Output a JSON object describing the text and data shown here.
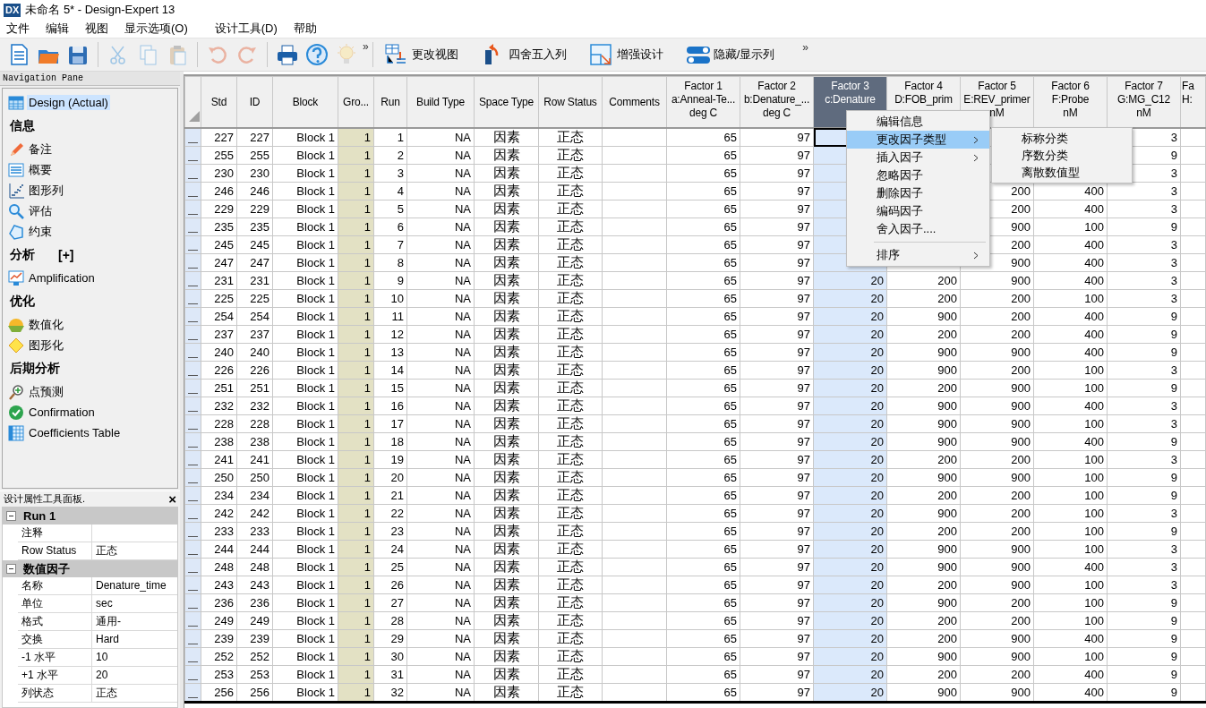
{
  "window": {
    "logo": "DX",
    "title": "未命名 5* - Design-Expert 13"
  },
  "menu_bar": [
    "文件",
    "编辑",
    "视图",
    "显示选项(O)",
    "设计工具(D)",
    "帮助"
  ],
  "toolbar": {
    "icon_buttons": [
      {
        "disabled": false
      },
      {
        "disabled": false
      },
      {
        "disabled": false
      },
      {
        "disabled": true
      },
      {
        "disabled": true
      },
      {
        "disabled": true
      },
      {
        "disabled": true
      },
      {
        "disabled": true
      },
      {
        "disabled": false
      },
      {
        "disabled": false
      },
      {
        "disabled": true
      }
    ],
    "overflow": "»",
    "view_buttons": [
      {
        "label": "更改视图"
      },
      {
        "label": "四舍五入列"
      },
      {
        "label": "增强设计"
      },
      {
        "label": "隐藏/显示列"
      }
    ],
    "view_overflow": "»"
  },
  "navigation_pane": {
    "title": "Navigation Pane",
    "items": [
      {
        "kind": "item",
        "label": "Design (Actual)",
        "selected": true
      },
      {
        "kind": "section",
        "label": "信息"
      },
      {
        "kind": "item",
        "label": "备注",
        "selected": false
      },
      {
        "kind": "item",
        "label": "概要",
        "selected": false
      },
      {
        "kind": "item",
        "label": "图形列",
        "selected": false
      },
      {
        "kind": "item",
        "label": "评估",
        "selected": false
      },
      {
        "kind": "item",
        "label": "约束",
        "selected": false
      },
      {
        "kind": "section",
        "label": "分析",
        "toggle": "[+]"
      },
      {
        "kind": "item",
        "label": "Amplification",
        "selected": false
      },
      {
        "kind": "section",
        "label": "优化"
      },
      {
        "kind": "item",
        "label": "数值化",
        "selected": false
      },
      {
        "kind": "item",
        "label": "图形化",
        "selected": false
      },
      {
        "kind": "section",
        "label": "后期分析"
      },
      {
        "kind": "item",
        "label": "点预测",
        "selected": false
      },
      {
        "kind": "item",
        "label": "Confirmation",
        "selected": false
      },
      {
        "kind": "item",
        "label": "Coefficients Table",
        "selected": false
      }
    ]
  },
  "properties_panel": {
    "title": "设计属性工具面板.",
    "close": "×",
    "groups": [
      {
        "title": "Run 1",
        "expanded": true,
        "rows": [
          {
            "name": "注释"
          },
          {
            "name": "Row Status",
            "value": "正态"
          }
        ]
      },
      {
        "title": "数值因子",
        "expanded": true,
        "rows": [
          {
            "name": "名称",
            "value": "Denature_time"
          },
          {
            "name": "单位",
            "value": "sec"
          },
          {
            "name": "格式",
            "value": "通用-"
          },
          {
            "name": "交换",
            "value": "Hard"
          },
          {
            "name": "-1 水平",
            "value": "10"
          },
          {
            "name": "+1 水平",
            "value": "20"
          },
          {
            "name": "列状态",
            "value": "正态"
          }
        ]
      }
    ]
  },
  "table": {
    "columns": [
      {
        "lines": [
          "Std"
        ],
        "selected": false
      },
      {
        "lines": [
          "ID"
        ],
        "selected": false
      },
      {
        "lines": [
          "Block"
        ],
        "selected": false
      },
      {
        "lines": [
          "Gro..."
        ],
        "selected": false
      },
      {
        "lines": [
          "Run"
        ],
        "selected": false
      },
      {
        "lines": [
          "Build Type"
        ],
        "selected": false
      },
      {
        "lines": [
          "Space Type"
        ],
        "selected": false
      },
      {
        "lines": [
          "Row Status"
        ],
        "selected": false
      },
      {
        "lines": [
          "Comments"
        ],
        "selected": false
      },
      {
        "lines": [
          "Factor 1",
          "a:Anneal-Te...",
          "deg C"
        ],
        "selected": false
      },
      {
        "lines": [
          "Factor 2",
          "b:Denature_...",
          "deg C"
        ],
        "selected": false
      },
      {
        "lines": [
          "Factor 3",
          "c:Denature"
        ],
        "selected": true
      },
      {
        "lines": [
          "Factor 4",
          "D:FOB_prim"
        ],
        "selected": false
      },
      {
        "lines": [
          "Factor 5",
          "E:REV_primer",
          "nM"
        ],
        "selected": false
      },
      {
        "lines": [
          "Factor 6",
          "F:Probe",
          "nM"
        ],
        "selected": false
      },
      {
        "lines": [
          "Factor 7",
          "G:MG_C12",
          "nM"
        ],
        "selected": false
      },
      {
        "lines": [
          "Fa",
          "H:"
        ],
        "selected": false
      }
    ],
    "rows": [
      {
        "current": true,
        "std": "227",
        "id": "227",
        "block": "Block 1",
        "group": "1",
        "run": "1",
        "build_type": "NA",
        "space_type": "因素",
        "row_status": "正态",
        "factor_1": "65",
        "factor_2": "97",
        "factor_7": "3"
      },
      {
        "current": false,
        "std": "255",
        "id": "255",
        "block": "Block 1",
        "group": "1",
        "run": "2",
        "build_type": "NA",
        "space_type": "因素",
        "row_status": "正态",
        "factor_1": "65",
        "factor_2": "97",
        "factor_7": "9"
      },
      {
        "current": false,
        "std": "230",
        "id": "230",
        "block": "Block 1",
        "group": "1",
        "run": "3",
        "build_type": "NA",
        "space_type": "因素",
        "row_status": "正态",
        "factor_1": "65",
        "factor_2": "97",
        "factor_7": "3"
      },
      {
        "current": false,
        "std": "246",
        "id": "246",
        "block": "Block 1",
        "group": "1",
        "run": "4",
        "build_type": "NA",
        "space_type": "因素",
        "row_status": "正态",
        "factor_1": "65",
        "factor_2": "97",
        "factor_5": "200",
        "factor_6": "400",
        "factor_7": "3"
      },
      {
        "current": false,
        "std": "229",
        "id": "229",
        "block": "Block 1",
        "group": "1",
        "run": "5",
        "build_type": "NA",
        "space_type": "因素",
        "row_status": "正态",
        "factor_1": "65",
        "factor_2": "97",
        "factor_5": "200",
        "factor_6": "400",
        "factor_7": "3"
      },
      {
        "current": false,
        "std": "235",
        "id": "235",
        "block": "Block 1",
        "group": "1",
        "run": "6",
        "build_type": "NA",
        "space_type": "因素",
        "row_status": "正态",
        "factor_1": "65",
        "factor_2": "97",
        "factor_5": "900",
        "factor_6": "100",
        "factor_7": "9"
      },
      {
        "current": false,
        "std": "245",
        "id": "245",
        "block": "Block 1",
        "group": "1",
        "run": "7",
        "build_type": "NA",
        "space_type": "因素",
        "row_status": "正态",
        "factor_1": "65",
        "factor_2": "97",
        "factor_5": "200",
        "factor_6": "400",
        "factor_7": "3"
      },
      {
        "current": false,
        "std": "247",
        "id": "247",
        "block": "Block 1",
        "group": "1",
        "run": "8",
        "build_type": "NA",
        "space_type": "因素",
        "row_status": "正态",
        "factor_1": "65",
        "factor_2": "97",
        "factor_5": "900",
        "factor_6": "400",
        "factor_7": "3"
      },
      {
        "current": false,
        "std": "231",
        "id": "231",
        "block": "Block 1",
        "group": "1",
        "run": "9",
        "build_type": "NA",
        "space_type": "因素",
        "row_status": "正态",
        "factor_1": "65",
        "factor_2": "97",
        "factor_3": "20",
        "factor_4": "200",
        "factor_5": "900",
        "factor_6": "400",
        "factor_7": "3"
      },
      {
        "current": false,
        "std": "225",
        "id": "225",
        "block": "Block 1",
        "group": "1",
        "run": "10",
        "build_type": "NA",
        "space_type": "因素",
        "row_status": "正态",
        "factor_1": "65",
        "factor_2": "97",
        "factor_3": "20",
        "factor_4": "200",
        "factor_5": "200",
        "factor_6": "100",
        "factor_7": "3"
      },
      {
        "current": false,
        "std": "254",
        "id": "254",
        "block": "Block 1",
        "group": "1",
        "run": "11",
        "build_type": "NA",
        "space_type": "因素",
        "row_status": "正态",
        "factor_1": "65",
        "factor_2": "97",
        "factor_3": "20",
        "factor_4": "900",
        "factor_5": "200",
        "factor_6": "400",
        "factor_7": "9"
      },
      {
        "current": false,
        "std": "237",
        "id": "237",
        "block": "Block 1",
        "group": "1",
        "run": "12",
        "build_type": "NA",
        "space_type": "因素",
        "row_status": "正态",
        "factor_1": "65",
        "factor_2": "97",
        "factor_3": "20",
        "factor_4": "200",
        "factor_5": "200",
        "factor_6": "400",
        "factor_7": "9"
      },
      {
        "current": false,
        "std": "240",
        "id": "240",
        "block": "Block 1",
        "group": "1",
        "run": "13",
        "build_type": "NA",
        "space_type": "因素",
        "row_status": "正态",
        "factor_1": "65",
        "factor_2": "97",
        "factor_3": "20",
        "factor_4": "900",
        "factor_5": "900",
        "factor_6": "400",
        "factor_7": "9"
      },
      {
        "current": false,
        "std": "226",
        "id": "226",
        "block": "Block 1",
        "group": "1",
        "run": "14",
        "build_type": "NA",
        "space_type": "因素",
        "row_status": "正态",
        "factor_1": "65",
        "factor_2": "97",
        "factor_3": "20",
        "factor_4": "900",
        "factor_5": "200",
        "factor_6": "100",
        "factor_7": "3"
      },
      {
        "current": false,
        "std": "251",
        "id": "251",
        "block": "Block 1",
        "group": "1",
        "run": "15",
        "build_type": "NA",
        "space_type": "因素",
        "row_status": "正态",
        "factor_1": "65",
        "factor_2": "97",
        "factor_3": "20",
        "factor_4": "200",
        "factor_5": "900",
        "factor_6": "100",
        "factor_7": "9"
      },
      {
        "current": false,
        "std": "232",
        "id": "232",
        "block": "Block 1",
        "group": "1",
        "run": "16",
        "build_type": "NA",
        "space_type": "因素",
        "row_status": "正态",
        "factor_1": "65",
        "factor_2": "97",
        "factor_3": "20",
        "factor_4": "900",
        "factor_5": "900",
        "factor_6": "400",
        "factor_7": "3"
      },
      {
        "current": false,
        "std": "228",
        "id": "228",
        "block": "Block 1",
        "group": "1",
        "run": "17",
        "build_type": "NA",
        "space_type": "因素",
        "row_status": "正态",
        "factor_1": "65",
        "factor_2": "97",
        "factor_3": "20",
        "factor_4": "900",
        "factor_5": "900",
        "factor_6": "100",
        "factor_7": "3"
      },
      {
        "current": false,
        "std": "238",
        "id": "238",
        "block": "Block 1",
        "group": "1",
        "run": "18",
        "build_type": "NA",
        "space_type": "因素",
        "row_status": "正态",
        "factor_1": "65",
        "factor_2": "97",
        "factor_3": "20",
        "factor_4": "900",
        "factor_5": "900",
        "factor_6": "400",
        "factor_7": "9"
      },
      {
        "current": false,
        "std": "241",
        "id": "241",
        "block": "Block 1",
        "group": "1",
        "run": "19",
        "build_type": "NA",
        "space_type": "因素",
        "row_status": "正态",
        "factor_1": "65",
        "factor_2": "97",
        "factor_3": "20",
        "factor_4": "200",
        "factor_5": "200",
        "factor_6": "100",
        "factor_7": "3"
      },
      {
        "current": false,
        "std": "250",
        "id": "250",
        "block": "Block 1",
        "group": "1",
        "run": "20",
        "build_type": "NA",
        "space_type": "因素",
        "row_status": "正态",
        "factor_1": "65",
        "factor_2": "97",
        "factor_3": "20",
        "factor_4": "900",
        "factor_5": "900",
        "factor_6": "100",
        "factor_7": "9"
      },
      {
        "current": false,
        "std": "234",
        "id": "234",
        "block": "Block 1",
        "group": "1",
        "run": "21",
        "build_type": "NA",
        "space_type": "因素",
        "row_status": "正态",
        "factor_1": "65",
        "factor_2": "97",
        "factor_3": "20",
        "factor_4": "200",
        "factor_5": "200",
        "factor_6": "100",
        "factor_7": "9"
      },
      {
        "current": false,
        "std": "242",
        "id": "242",
        "block": "Block 1",
        "group": "1",
        "run": "22",
        "build_type": "NA",
        "space_type": "因素",
        "row_status": "正态",
        "factor_1": "65",
        "factor_2": "97",
        "factor_3": "20",
        "factor_4": "900",
        "factor_5": "200",
        "factor_6": "100",
        "factor_7": "3"
      },
      {
        "current": false,
        "std": "233",
        "id": "233",
        "block": "Block 1",
        "group": "1",
        "run": "23",
        "build_type": "NA",
        "space_type": "因素",
        "row_status": "正态",
        "factor_1": "65",
        "factor_2": "97",
        "factor_3": "20",
        "factor_4": "200",
        "factor_5": "200",
        "factor_6": "100",
        "factor_7": "9"
      },
      {
        "current": false,
        "std": "244",
        "id": "244",
        "block": "Block 1",
        "group": "1",
        "run": "24",
        "build_type": "NA",
        "space_type": "因素",
        "row_status": "正态",
        "factor_1": "65",
        "factor_2": "97",
        "factor_3": "20",
        "factor_4": "900",
        "factor_5": "900",
        "factor_6": "100",
        "factor_7": "3"
      },
      {
        "current": false,
        "std": "248",
        "id": "248",
        "block": "Block 1",
        "group": "1",
        "run": "25",
        "build_type": "NA",
        "space_type": "因素",
        "row_status": "正态",
        "factor_1": "65",
        "factor_2": "97",
        "factor_3": "20",
        "factor_4": "900",
        "factor_5": "900",
        "factor_6": "400",
        "factor_7": "3"
      },
      {
        "current": false,
        "std": "243",
        "id": "243",
        "block": "Block 1",
        "group": "1",
        "run": "26",
        "build_type": "NA",
        "space_type": "因素",
        "row_status": "正态",
        "factor_1": "65",
        "factor_2": "97",
        "factor_3": "20",
        "factor_4": "200",
        "factor_5": "900",
        "factor_6": "100",
        "factor_7": "3"
      },
      {
        "current": false,
        "std": "236",
        "id": "236",
        "block": "Block 1",
        "group": "1",
        "run": "27",
        "build_type": "NA",
        "space_type": "因素",
        "row_status": "正态",
        "factor_1": "65",
        "factor_2": "97",
        "factor_3": "20",
        "factor_4": "900",
        "factor_5": "200",
        "factor_6": "100",
        "factor_7": "9"
      },
      {
        "current": false,
        "std": "249",
        "id": "249",
        "block": "Block 1",
        "group": "1",
        "run": "28",
        "build_type": "NA",
        "space_type": "因素",
        "row_status": "正态",
        "factor_1": "65",
        "factor_2": "97",
        "factor_3": "20",
        "factor_4": "200",
        "factor_5": "200",
        "factor_6": "100",
        "factor_7": "9"
      },
      {
        "current": false,
        "std": "239",
        "id": "239",
        "block": "Block 1",
        "group": "1",
        "run": "29",
        "build_type": "NA",
        "space_type": "因素",
        "row_status": "正态",
        "factor_1": "65",
        "factor_2": "97",
        "factor_3": "20",
        "factor_4": "200",
        "factor_5": "900",
        "factor_6": "400",
        "factor_7": "9"
      },
      {
        "current": false,
        "std": "252",
        "id": "252",
        "block": "Block 1",
        "group": "1",
        "run": "30",
        "build_type": "NA",
        "space_type": "因素",
        "row_status": "正态",
        "factor_1": "65",
        "factor_2": "97",
        "factor_3": "20",
        "factor_4": "900",
        "factor_5": "900",
        "factor_6": "100",
        "factor_7": "9"
      },
      {
        "current": false,
        "std": "253",
        "id": "253",
        "block": "Block 1",
        "group": "1",
        "run": "31",
        "build_type": "NA",
        "space_type": "因素",
        "row_status": "正态",
        "factor_1": "65",
        "factor_2": "97",
        "factor_3": "20",
        "factor_4": "200",
        "factor_5": "200",
        "factor_6": "400",
        "factor_7": "9"
      },
      {
        "current": false,
        "std": "256",
        "id": "256",
        "block": "Block 1",
        "group": "1",
        "run": "32",
        "build_type": "NA",
        "space_type": "因素",
        "row_status": "正态",
        "factor_1": "65",
        "factor_2": "97",
        "factor_3": "20",
        "factor_4": "900",
        "factor_5": "900",
        "factor_6": "400",
        "factor_7": "9"
      }
    ]
  },
  "context_menu": {
    "items": [
      {
        "kind": "item",
        "label": "编辑信息",
        "selected": false
      },
      {
        "kind": "submenu",
        "label": "更改因子类型",
        "selected": true
      },
      {
        "kind": "submenu",
        "label": "插入因子",
        "selected": false
      },
      {
        "kind": "item",
        "label": "忽略因子",
        "selected": false
      },
      {
        "kind": "item",
        "label": "删除因子",
        "selected": false
      },
      {
        "kind": "item",
        "label": "编码因子",
        "selected": false
      },
      {
        "kind": "item",
        "label": "舍入因子....",
        "selected": false
      },
      {
        "kind": "separator"
      },
      {
        "kind": "submenu",
        "label": "排序",
        "selected": false
      }
    ],
    "submenu": [
      "标称分类",
      "序数分类",
      "离散数值型"
    ]
  }
}
